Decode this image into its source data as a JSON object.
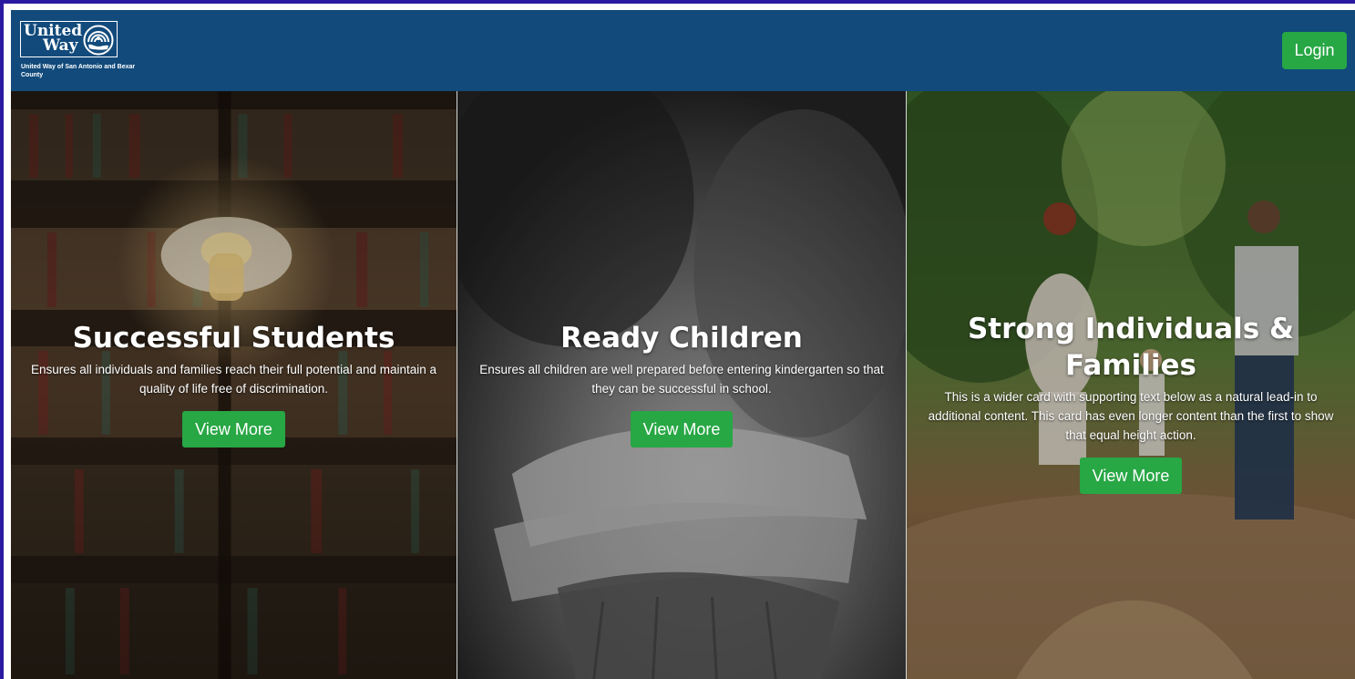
{
  "header": {
    "logo_line1": "United",
    "logo_line2": "Way",
    "logo_subtitle": "United Way of San Antonio and Bexar County",
    "login_label": "Login",
    "background_color": "#114a7b",
    "login_color": "#28a745"
  },
  "cards": [
    {
      "title": "Successful Students",
      "text": "Ensures all individuals and families reach their full potential and maintain a quality of life free of discrimination.",
      "button_label": "View More"
    },
    {
      "title": "Ready Children",
      "text": "Ensures all children are well prepared before entering kindergarten so that they can be successful in school.",
      "button_label": "View More"
    },
    {
      "title": "Strong Individuals & Families",
      "text": "This is a wider card with supporting text below as a natural lead-in to additional content. This card has even longer content than the first to show that equal height action.",
      "button_label": "View More"
    }
  ]
}
